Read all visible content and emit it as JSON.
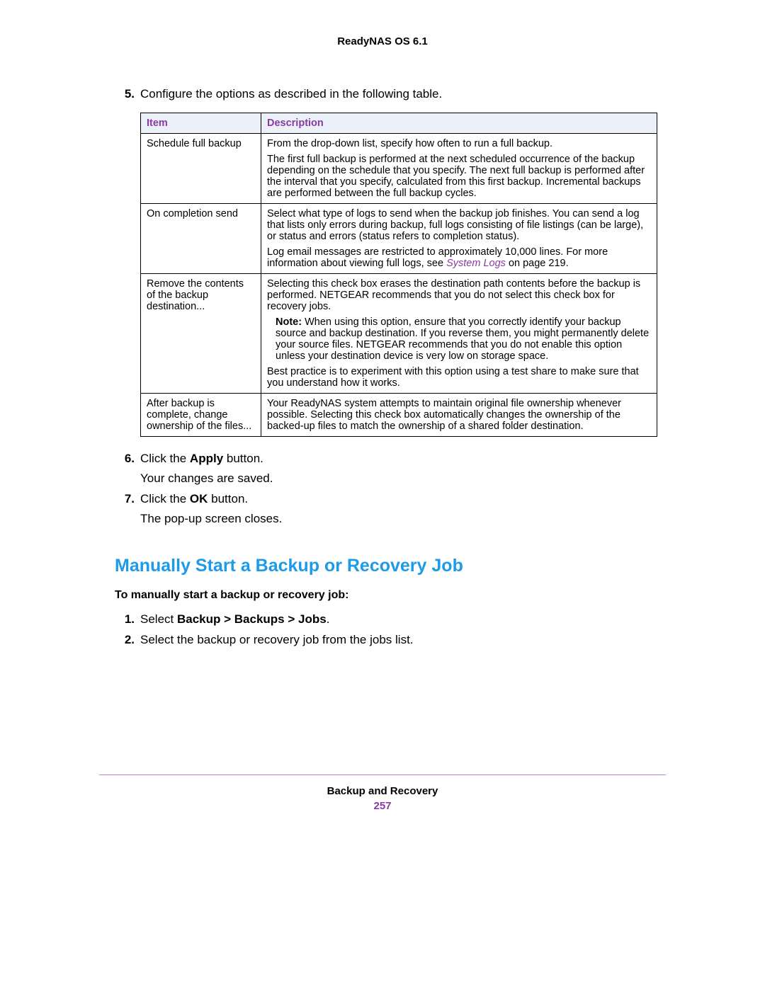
{
  "header": {
    "product": "ReadyNAS OS 6.1"
  },
  "steps_top": {
    "s5": {
      "num": "5.",
      "text": "Configure the options as described in the following table."
    },
    "s6": {
      "num": "6.",
      "prefix": "Click the ",
      "bold": "Apply",
      "suffix": " button.",
      "result": "Your changes are saved."
    },
    "s7": {
      "num": "7.",
      "prefix": "Click the ",
      "bold": "OK",
      "suffix": " button.",
      "result": "The pop-up screen closes."
    }
  },
  "table": {
    "headers": {
      "col1": "Item",
      "col2": "Description"
    },
    "rows": [
      {
        "item": "Schedule full backup",
        "p1": "From the drop-down list, specify how often to run a full backup.",
        "p2": "The first full backup is performed at the next scheduled occurrence of the backup depending on the schedule that you specify. The next full backup is performed after the interval that you specify, calculated from this first backup. Incremental backups are performed between the full backup cycles."
      },
      {
        "item": "On completion send",
        "p1": "Select what type of logs to send when the backup job finishes. You can send a log that lists only errors during backup, full logs consisting of file listings (can be large), or status and errors (status refers to completion status).",
        "p2a": "Log email messages are restricted to approximately 10,000 lines. For more information about viewing full logs, see ",
        "p2link": "System Logs",
        "p2b": " on page 219."
      },
      {
        "item": "Remove the contents of the backup destination...",
        "p1": "Selecting this check box erases the destination path contents before the backup is performed. NETGEAR recommends that you do not select this check box for recovery jobs.",
        "note_label": "Note: ",
        "note_text": "When using this option, ensure that you correctly identify your backup source and backup destination. If you reverse them, you might permanently delete your source files. NETGEAR recommends that you do not enable this option unless your destination device is very low on storage space.",
        "p3": "Best practice is to experiment with this option using a test share to make sure that you understand how it works."
      },
      {
        "item": "After backup is complete, change ownership of the files...",
        "p1": "Your ReadyNAS system attempts to maintain original file ownership whenever possible. Selecting this check box automatically changes the ownership of the backed-up files to match the ownership of a shared folder destination."
      }
    ]
  },
  "section": {
    "heading": "Manually Start a Backup or Recovery Job",
    "subhead": "To manually start a backup or recovery job:",
    "s1": {
      "num": "1.",
      "prefix": "Select ",
      "bold": "Backup > Backups > Jobs",
      "suffix": "."
    },
    "s2": {
      "num": "2.",
      "text": "Select the backup or recovery job from the jobs list."
    }
  },
  "footer": {
    "chapter": "Backup and Recovery",
    "page": "257"
  }
}
